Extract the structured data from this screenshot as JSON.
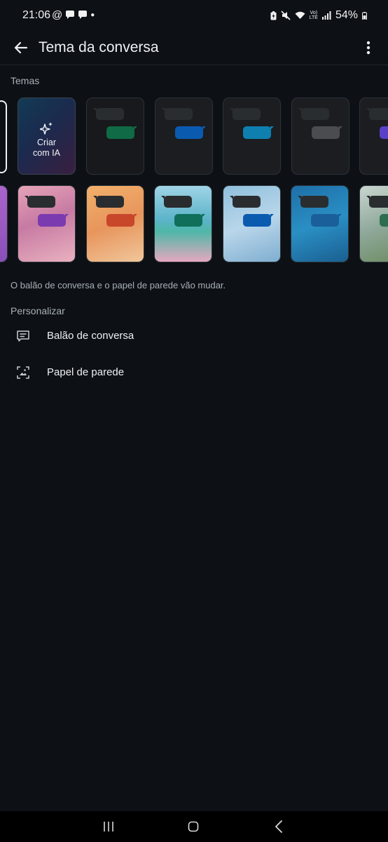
{
  "status_bar": {
    "time": "21:06",
    "left_icons": [
      "at-sign-icon",
      "chat-bubble-icon",
      "chat-bubble-icon",
      "dot-icon"
    ],
    "right_icons": [
      "battery-saver-icon",
      "mute-icon",
      "wifi-icon",
      "volte-icon",
      "signal-icon"
    ],
    "battery": "54%"
  },
  "header": {
    "title": "Tema da conversa",
    "back_icon": "arrow-left-icon",
    "menu_icon": "more-vertical-icon"
  },
  "themes": {
    "section_label": "Temas",
    "ai_card_label": "Criar com IA",
    "ai_card_label_line1": "Criar",
    "ai_card_label_line2": "com IA",
    "row1": [
      {
        "bg": "#17191c",
        "out": "#0f6a45"
      },
      {
        "bg": "#1b1d20",
        "out": "#0a5bb0"
      },
      {
        "bg": "#1b1d20",
        "out": "#0f7fb0"
      },
      {
        "bg": "#1b1d20",
        "out": "#4a4c50"
      },
      {
        "bg": "#1b1d20",
        "out": "#5a3fc8"
      }
    ],
    "row2": [
      {
        "bg": "linear-gradient(160deg,#e6a3b8,#c77aa3 45%,#e9b1bf)",
        "out": "#7b3ab0"
      },
      {
        "bg": "linear-gradient(160deg,#f1b06a,#e8955c 50%,#f0c79b)",
        "out": "#c8472b"
      },
      {
        "bg": "linear-gradient(180deg,#9fd4e6 0%,#5bb3c9 45%,#4fb7a7 60%,#e6a8c0 100%)",
        "out": "#0f6f5a"
      },
      {
        "bg": "linear-gradient(160deg,#8fc0dc,#b9d6ea 50%,#7faed0)",
        "out": "#0a5bb0"
      },
      {
        "bg": "linear-gradient(160deg,#1e6fa8,#2a8fc4 50%,#1a5f90)",
        "out": "#1a5f9a"
      },
      {
        "bg": "linear-gradient(160deg,#c9d6d0,#8fa89a 50%,#6a8a5e)",
        "out": "#2c6e4f"
      }
    ]
  },
  "caption": "O balão de conversa e o papel de parede vão mudar.",
  "personalize": {
    "section_label": "Personalizar",
    "items": [
      {
        "label": "Balão de conversa",
        "icon": "chat-bubble-outline-icon"
      },
      {
        "label": "Papel de parede",
        "icon": "wallpaper-icon"
      }
    ]
  },
  "nav": {
    "recents_icon": "recents-icon",
    "home_icon": "home-icon",
    "back_icon": "nav-back-icon"
  }
}
